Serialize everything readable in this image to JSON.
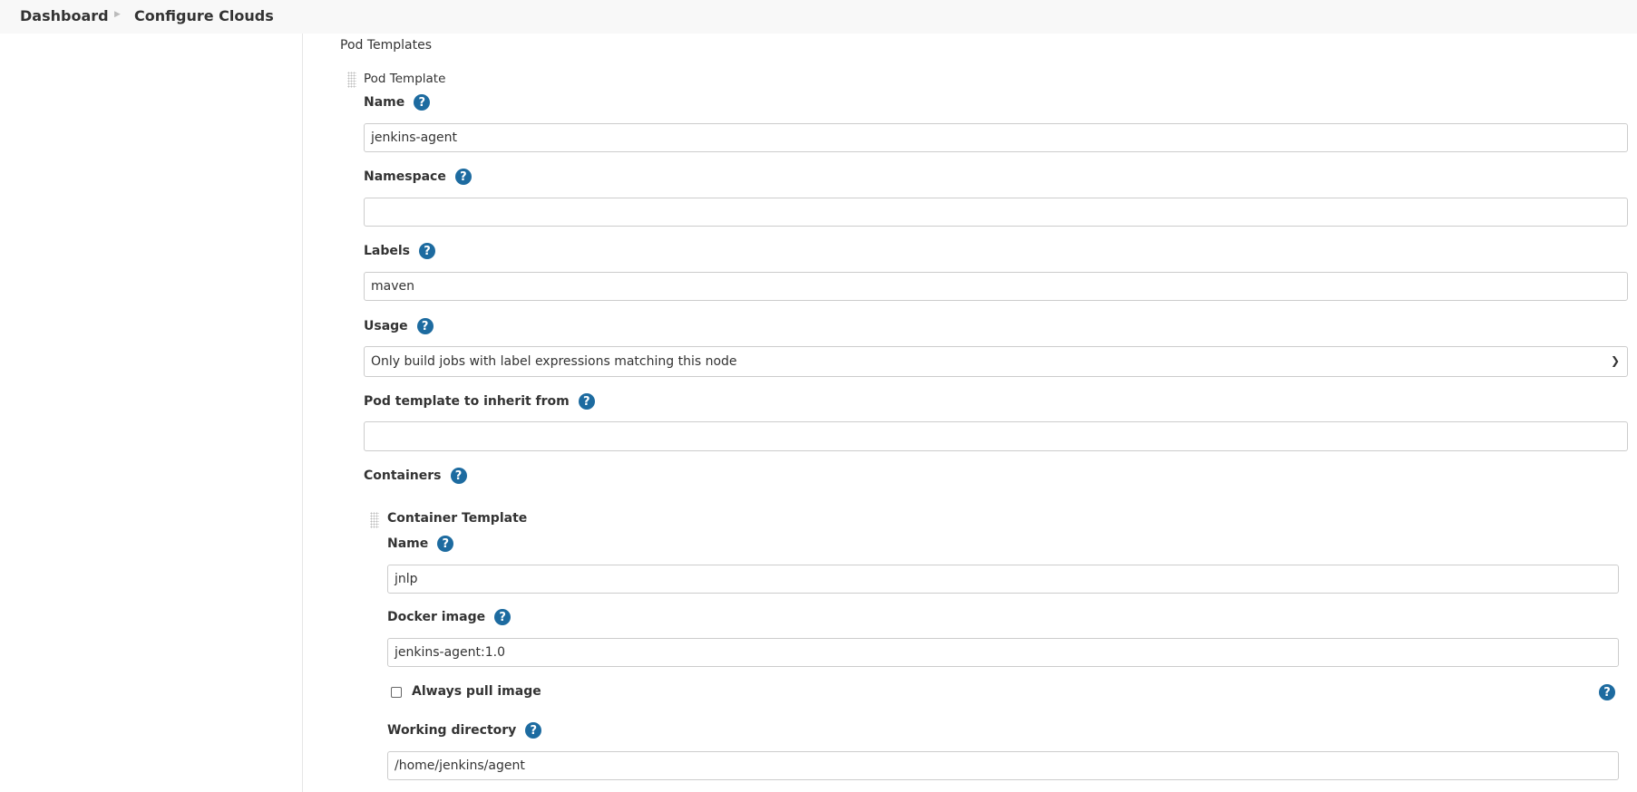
{
  "breadcrumb": {
    "items": [
      "Dashboard",
      "Configure Clouds"
    ]
  },
  "section_title": "Pod Templates",
  "pod_template": {
    "title": "Pod Template",
    "fields": {
      "name": {
        "label": "Name",
        "value": "jenkins-agent"
      },
      "namespace": {
        "label": "Namespace",
        "value": ""
      },
      "labels": {
        "label": "Labels",
        "value": "maven"
      },
      "usage": {
        "label": "Usage",
        "value": "Only build jobs with label expressions matching this node"
      },
      "inherit": {
        "label": "Pod template to inherit from",
        "value": ""
      },
      "containers": {
        "label": "Containers"
      }
    }
  },
  "container_template": {
    "title": "Container Template",
    "name": {
      "label": "Name",
      "value": "jnlp"
    },
    "docker_image": {
      "label": "Docker image",
      "value": "jenkins-agent:1.0"
    },
    "always_pull": {
      "label": "Always pull image",
      "checked": false
    },
    "working_dir": {
      "label": "Working directory",
      "value": "/home/jenkins/agent"
    }
  },
  "icons": {
    "help": "help-icon",
    "help_glyph": "?"
  },
  "colors": {
    "help": "#1d6ba0"
  }
}
